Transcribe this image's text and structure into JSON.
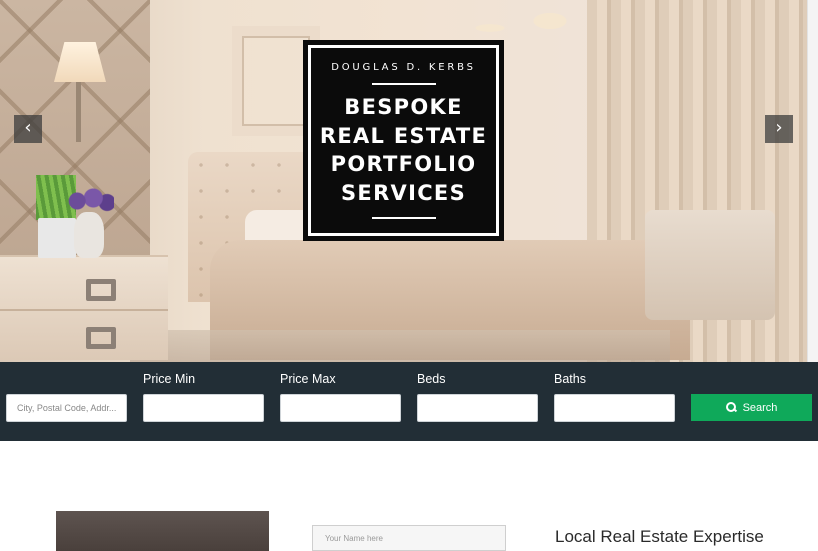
{
  "hero": {
    "logo_name": "DOUGLAS D. KERBS",
    "logo_title_lines": [
      "BESPOKE",
      "REAL ESTATE",
      "PORTFOLIO",
      "SERVICES"
    ],
    "prev_arrow": "‹",
    "next_arrow": "›"
  },
  "search": {
    "location_placeholder": "City, Postal Code, Addr...",
    "price_min_label": "Price Min",
    "price_max_label": "Price Max",
    "beds_label": "Beds",
    "baths_label": "Baths",
    "search_button": "Search",
    "colors": {
      "bar": "#222e36",
      "button": "#0fa95a"
    }
  },
  "contact": {
    "name_placeholder": "Your Name here"
  },
  "section": {
    "heading": "Local Real Estate Expertise"
  }
}
